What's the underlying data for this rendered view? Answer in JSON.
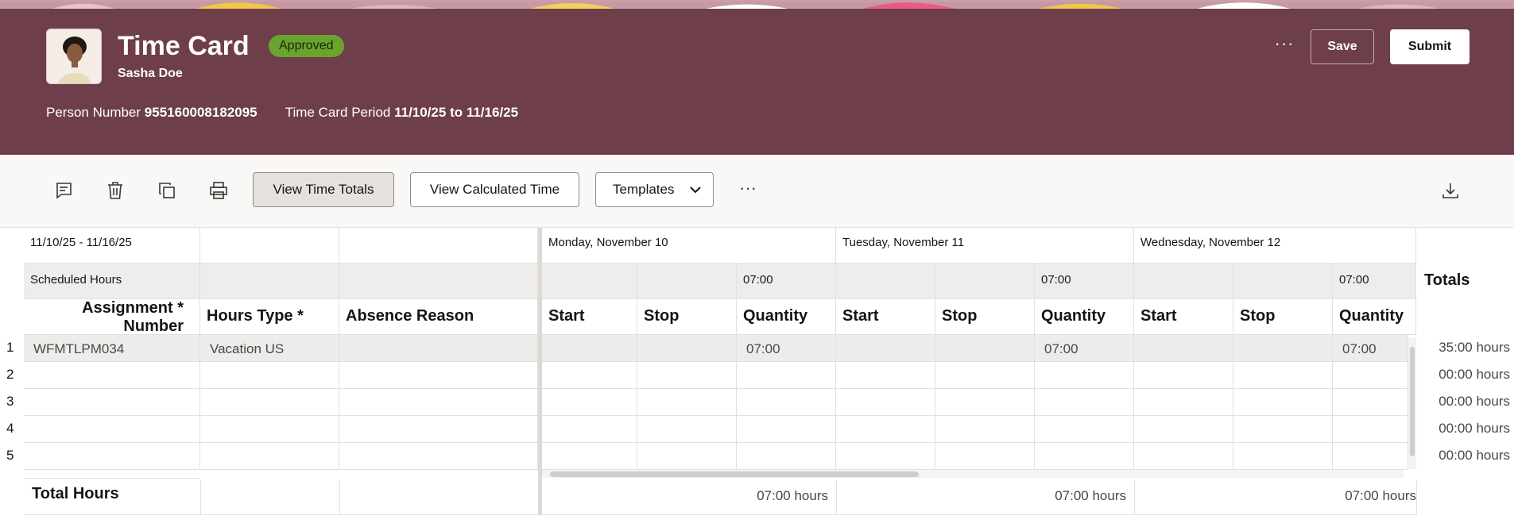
{
  "header": {
    "title": "Time Card",
    "status": "Approved",
    "person_name": "Sasha Doe",
    "person_number_label": "Person Number",
    "person_number": "955160008182095",
    "period_label": "Time Card Period",
    "period_value": "11/10/25 to 11/16/25",
    "more_label": "···",
    "save_label": "Save",
    "submit_label": "Submit"
  },
  "toolbar": {
    "view_time_totals": "View Time Totals",
    "view_calculated_time": "View Calculated Time",
    "templates": "Templates",
    "more_label": "···",
    "icons": [
      "comment-icon",
      "delete-icon",
      "copy-icon",
      "print-icon",
      "download-icon"
    ]
  },
  "grid": {
    "period_range": "11/10/25 - 11/16/25",
    "scheduled_hours_label": "Scheduled Hours",
    "totals_label": "Totals",
    "columns": {
      "assignment_line1": "Assignment",
      "assignment_line2": "Number",
      "required_mark": "*",
      "hours_type": "Hours Type *",
      "absence_reason": "Absence Reason"
    },
    "days": [
      {
        "date": "Monday, November 10",
        "scheduled": "07:00",
        "start": "Start",
        "stop": "Stop",
        "quantity": "Quantity",
        "total": "07:00 hours"
      },
      {
        "date": "Tuesday, November 11",
        "scheduled": "07:00",
        "start": "Start",
        "stop": "Stop",
        "quantity": "Quantity",
        "total": "07:00 hours"
      },
      {
        "date": "Wednesday, November 12",
        "scheduled": "07:00",
        "start": "Start",
        "stop": "Stop",
        "quantity": "Quantity",
        "total": "07:00 hours"
      }
    ],
    "rows": [
      {
        "num": "1",
        "assignment": "WFMTLPM034",
        "hours_type": "Vacation US",
        "q1": "07:00",
        "q2": "07:00",
        "q3": "07:00",
        "total": "35:00 hours"
      },
      {
        "num": "2",
        "assignment": "",
        "hours_type": "",
        "q1": "",
        "q2": "",
        "q3": "",
        "total": "00:00 hours"
      },
      {
        "num": "3",
        "assignment": "",
        "hours_type": "",
        "q1": "",
        "q2": "",
        "q3": "",
        "total": "00:00 hours"
      },
      {
        "num": "4",
        "assignment": "",
        "hours_type": "",
        "q1": "",
        "q2": "",
        "q3": "",
        "total": "00:00 hours"
      },
      {
        "num": "5",
        "assignment": "",
        "hours_type": "",
        "q1": "",
        "q2": "",
        "q3": "",
        "total": "00:00 hours"
      }
    ],
    "footer_label": "Total Hours"
  },
  "colors": {
    "header_bg": "#6e3e4b",
    "status_badge": "#6aa32e",
    "toolbar_bg": "#f9f8f6"
  }
}
